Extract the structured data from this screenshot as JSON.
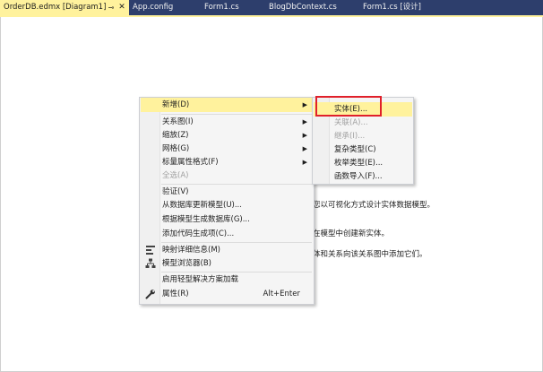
{
  "tabs": [
    {
      "label": "OrderDB.edmx [Diagram1]",
      "pin_icon": "pin-icon",
      "close_icon": "close-icon"
    },
    {
      "label": "App.config"
    },
    {
      "label": "Form1.cs"
    },
    {
      "label": "BlogDbContext.cs"
    },
    {
      "label": "Form1.cs [设计]"
    }
  ],
  "canvas_hints": [
    "您以可视化方式设计实体数据模型。",
    "在模型中创建新实体。",
    "体和关系向该关系图中添加它们。"
  ],
  "context_menu": {
    "items": [
      {
        "label": "新增(D)",
        "submenu": true
      },
      {
        "label": "关系图(I)",
        "submenu": true
      },
      {
        "label": "缩放(Z)",
        "submenu": true
      },
      {
        "label": "网格(G)",
        "submenu": true
      },
      {
        "label": "标量属性格式(F)",
        "submenu": true
      },
      {
        "label": "全选(A)",
        "disabled": true
      },
      {
        "label": "验证(V)"
      },
      {
        "label": "从数据库更新模型(U)..."
      },
      {
        "label": "根据模型生成数据库(G)..."
      },
      {
        "label": "添加代码生成项(C)..."
      },
      {
        "label": "映射详细信息(M)",
        "icon": "mapping-details-icon"
      },
      {
        "label": "模型浏览器(B)",
        "icon": "model-browser-icon"
      },
      {
        "label": "启用轻型解决方案加载"
      },
      {
        "label": "属性(R)",
        "shortcut": "Alt+Enter",
        "icon": "wrench-icon"
      }
    ]
  },
  "submenu": {
    "items": [
      {
        "label": "实体(E)..."
      },
      {
        "label": "关联(A)...",
        "disabled": true
      },
      {
        "label": "继承(I)...",
        "disabled": true
      },
      {
        "label": "复杂类型(C)"
      },
      {
        "label": "枚举类型(E)..."
      },
      {
        "label": "函数导入(F)..."
      }
    ]
  },
  "colors": {
    "tab_bar": "#2d3e6c",
    "highlight": "#fff29d",
    "annotation": "#e0202a"
  }
}
